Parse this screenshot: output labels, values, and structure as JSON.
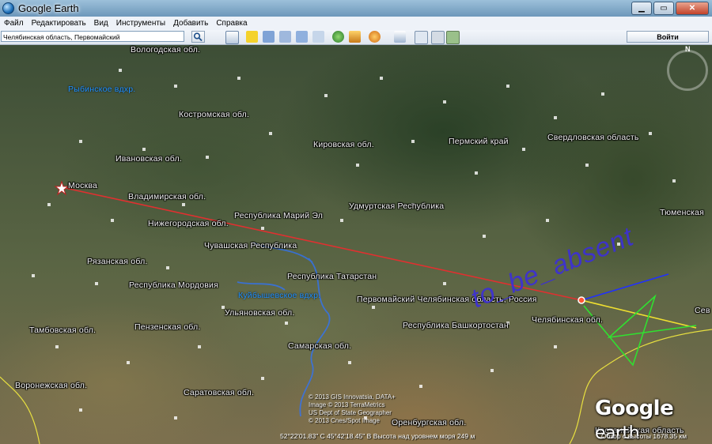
{
  "window": {
    "title": "Google Earth",
    "minimize": "▁",
    "maximize": "▭",
    "close": "✕"
  },
  "menu": [
    "Файл",
    "Редактировать",
    "Вид",
    "Инструменты",
    "Добавить",
    "Справка"
  ],
  "search": {
    "value": "Челябинская область, Первомайский",
    "icon": "search-icon"
  },
  "toolbar": {
    "signin_label": "Войти"
  },
  "map": {
    "labels": [
      "Вологодская обл.",
      "Рыбинское вдхр.",
      "Костромская обл.",
      "Кировская обл.",
      "Пермский край",
      "Свердловская область",
      "Ивановская обл.",
      "Москва",
      "Владимирская обл.",
      "Республика Марий Эл",
      "Удмуртская Республика",
      "Нижегородская обл.",
      "Тюменская",
      "Чувашская Республика",
      "Рязанская обл.",
      "Республика Татарстан",
      "Республика Мордовия",
      "Куйбышевское вдхр.",
      "Первомайский  Челябинская область, Россия",
      "Ульяновская обл.",
      "Республика Башкортостан",
      "Челябинская обл.",
      "Тамбовская обл.",
      "Пензенская обл.",
      "Самарская обл.",
      "Воронежская обл.",
      "Саратовская обл.",
      "Оренбургская обл.",
      "Костанайская область",
      "Сев"
    ],
    "copyright": [
      "© 2013 GIS Innovatsia, DATA+",
      "Image © 2013 TerraMetrics",
      "US Dept of State Geographer",
      "© 2013 Cnes/Spot Image"
    ],
    "status": "52°22'01.83\" С   45°42'18.45\" В Высота над уровнем моря   249 м",
    "altitude": "Обзор с высоты  1678.35 км",
    "logo": [
      "Google",
      "earth"
    ],
    "watermark": "to_be_absent",
    "north": "N"
  }
}
